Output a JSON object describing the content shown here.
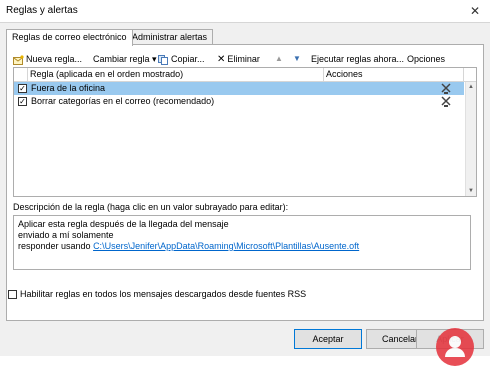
{
  "window": {
    "title": "Reglas y alertas",
    "close_glyph": "✕"
  },
  "tabs": [
    {
      "label": "Reglas de correo electrónico",
      "active": true
    },
    {
      "label": "Administrar alertas",
      "active": false
    }
  ],
  "toolbar": {
    "new_rule": "Nueva regla...",
    "change_rule": "Cambiar regla",
    "copy": "Copiar...",
    "delete": "Eliminar",
    "run_rules": "Ejecutar reglas ahora...",
    "options": "Opciones"
  },
  "rules_list": {
    "columns": [
      "Regla (aplicada en el orden mostrado)",
      "Acciones"
    ],
    "rows": [
      {
        "name": "Fuera de la oficina",
        "checked": true,
        "selected": true
      },
      {
        "name": "Borrar categorías en el correo (recomendado)",
        "checked": true,
        "selected": false
      }
    ]
  },
  "description": {
    "label": "Descripción de la regla (haga clic en un valor subrayado para editar):",
    "lines": [
      "Aplicar esta regla después de la llegada del mensaje",
      "enviado a mí solamente",
      "responder usando "
    ],
    "link": "C:\\Users\\Jenifer\\AppData\\Roaming\\Microsoft\\Plantillas\\Ausente.oft"
  },
  "rss_option": {
    "label": "Habilitar reglas en todos los mensajes descargados desde fuentes RSS",
    "checked": false
  },
  "buttons": {
    "ok": "Aceptar",
    "cancel": "Cancelar",
    "apply": "Aplicar"
  },
  "colors": {
    "selection": "#99c9ef",
    "link": "#0066cc",
    "primary_border": "#0078d7"
  }
}
